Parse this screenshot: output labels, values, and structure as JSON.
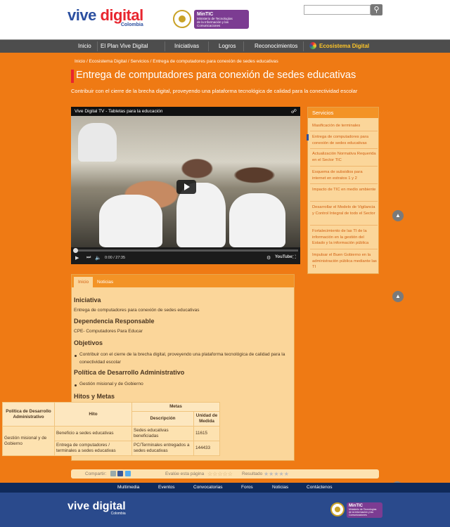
{
  "header": {
    "logo_top": "vive",
    "logo_main": "digital",
    "logo_sub": "Colombia",
    "ministry_name": "MinTIC",
    "ministry_line1": "Ministerio de Tecnologías",
    "ministry_line2": "de la Información y las Comunicaciones",
    "search_placeholder": ""
  },
  "nav": {
    "items": [
      "Inicio",
      "El Plan Vive Digital",
      "Iniciativas",
      "Logros",
      "Reconocimientos",
      "Ecosistema Digital"
    ]
  },
  "breadcrumb": "Inicio / Ecosistema Digital / Servicios / Entrega de computadores para conexión de sedes educativas",
  "page": {
    "title": "Entrega de computadores para conexión de sedes educativas",
    "subtitle": "Contribuir con el cierre de la brecha digital, proveyendo una plataforma tecnológica de calidad para la conectividad escolar"
  },
  "video": {
    "title": "Vive Digital TV - Tabletas para la educación",
    "time": "0:00 / 27:35",
    "brand": "YouTube"
  },
  "side": {
    "heading": "Servicios",
    "items": [
      "Masificación de terminales",
      "Entrega de computadores para conexión de sedes educativas",
      "Actualización Normativa Requerida en el Sector TIC",
      "Esquema de subsidios para internet en estratos 1 y 2",
      "Impacto de TIC en medio ambiente",
      "Desarrollar el Modelo de Vigilancia y Control Integral de todo el Sector",
      "Fortalecimiento de las TI de la información en la gestión del Estado y la información pública",
      "Impulsar el Buen Gobierno en la administración pública mediante las TI"
    ]
  },
  "panel": {
    "tabs": [
      "Inicio",
      "Noticias"
    ],
    "iniciativa_h": "Iniciativa",
    "iniciativa": "Entrega de computadores para conexión de sedes educativas",
    "dependencia_h": "Dependencia Responsable",
    "dependencia": "CPE- Computadores Para Educar",
    "objetivos_h": "Objetivos",
    "objetivo": "Contribuir con el cierre de la brecha digital, proveyendo una plataforma tecnológica de calidad para la conectividad escolar",
    "politica_h": "Política de Desarrollo Administrativo",
    "politica": "Gestión misional y de Gobierno",
    "hitos_h": "Hitos y Metas",
    "table": {
      "col_politica": "Política de Desarrollo Administrativo",
      "col_hito": "Hito",
      "col_metas": "Metas",
      "col_desc": "Descripción",
      "col_unidad": "Unidad de Medida",
      "politica_value": "Gestión misional y de Gobierno",
      "rows": [
        {
          "hito": "Beneficio a sedes educativas",
          "desc": "Sedes educativas beneficiadas",
          "unidad": "11615"
        },
        {
          "hito": "Entrega de computadores / terminales a sedes educativas",
          "desc": "PC/Terminales entregados a sedes educativas",
          "unidad": "144433"
        }
      ]
    }
  },
  "sharebar": {
    "share": "Compartir:",
    "rate": "Evalúe esta página",
    "result": "Resultado",
    "stars_empty": "☆☆☆☆☆",
    "stars_result": "★★★★★"
  },
  "footer": {
    "links": [
      "Multimedia",
      "Eventos",
      "Convocatorias",
      "Foros",
      "Noticias",
      "Contáctenos"
    ],
    "logo_top": "vive digital",
    "logo_sub": "Colombia"
  },
  "colors": {
    "brand_orange": "#ef7a14",
    "brand_blue": "#2b4fa0",
    "brand_red": "#e8262f",
    "ministry_purple": "#7c3c92"
  },
  "icons": {
    "search": "search-icon",
    "share": "share-icon",
    "play": "play-icon",
    "to_top": "arrow-up-icon"
  }
}
